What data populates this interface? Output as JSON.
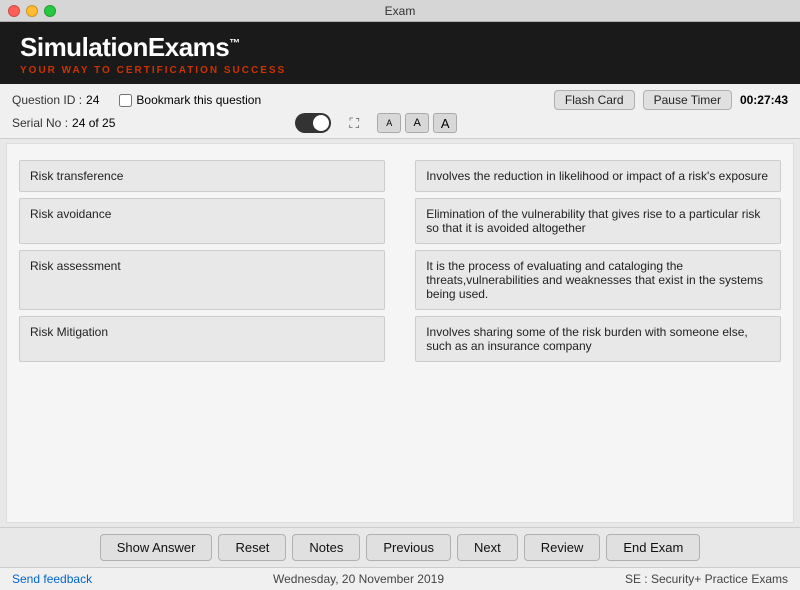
{
  "titlebar": {
    "title": "Exam"
  },
  "header": {
    "app_name": "SimulationExams",
    "trademark": "™",
    "subtitle_prefix": "YOUR WAY TO CERTIFICATION ",
    "subtitle_accent": "SUCCESS"
  },
  "info": {
    "question_id_label": "Question ID :",
    "question_id_value": "24",
    "serial_no_label": "Serial No :",
    "serial_no_value": "24 of 25",
    "bookmark_label": "Bookmark this question",
    "flash_card_label": "Flash Card",
    "pause_timer_label": "Pause Timer",
    "timer_value": "00:27:43"
  },
  "font_buttons": [
    "A",
    "A",
    "A"
  ],
  "matching_pairs": [
    {
      "term": "Risk transference",
      "definition": "Involves the reduction in likelihood or impact of a risk's exposure"
    },
    {
      "term": "Risk avoidance",
      "definition": "Elimination of the vulnerability that gives rise to a particular risk so that it is avoided altogether"
    },
    {
      "term": "Risk assessment",
      "definition": "It is the process of evaluating and cataloging the threats,vulnerabilities and weaknesses that exist in the systems being used."
    },
    {
      "term": "Risk Mitigation",
      "definition": "Involves sharing some of the risk burden with someone else, such as an insurance company"
    }
  ],
  "buttons": {
    "show_answer": "Show Answer",
    "reset": "Reset",
    "notes": "Notes",
    "previous": "Previous",
    "next": "Next",
    "review": "Review",
    "end_exam": "End Exam"
  },
  "footer": {
    "feedback": "Send feedback",
    "date": "Wednesday, 20 November 2019",
    "brand": "SE : Security+ Practice Exams"
  }
}
